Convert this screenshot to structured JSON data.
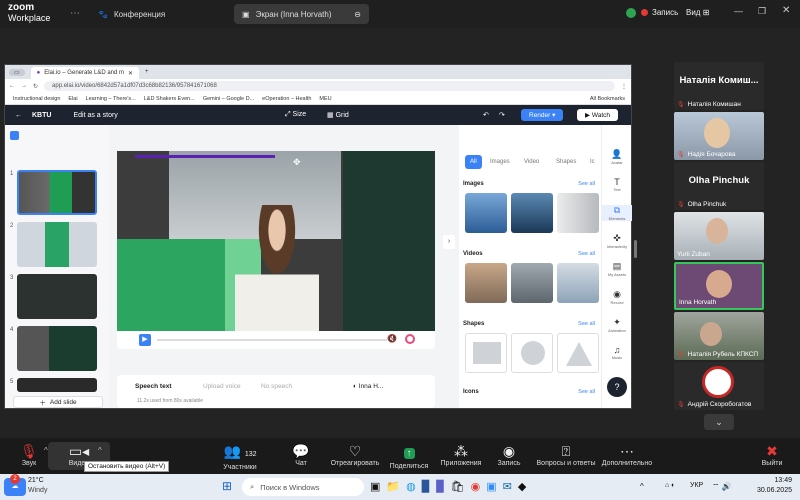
{
  "zoom": {
    "logo_top": "zoom",
    "logo_bottom": "Workplace",
    "tabs": [
      {
        "label": "Конференция",
        "icon": "paw-icon"
      },
      {
        "label": "Экран (Inna Horvath)",
        "icon": "screen-icon"
      }
    ],
    "recording_label": "Запись",
    "view_label": "Вид"
  },
  "browser": {
    "tab_title": "Elai.io – Generate L&D and m",
    "url": "app.elai.io/video/6842d57a1df07d3c68b82136/957841671068",
    "bookmarks": [
      "Instructional design",
      "Elai",
      "Learning – There's...",
      "L&D Shakers Even...",
      "Gemini – Google D...",
      "eOperation – Health",
      "MEU"
    ],
    "all_bookmarks": "All Bookmarks"
  },
  "elai": {
    "project": "KBTU",
    "edit_story": "Edit as a story",
    "size": "Size",
    "grid": "Grid",
    "render": "Render",
    "watch": "Watch",
    "slides": [
      "1",
      "2",
      "3",
      "4",
      "5"
    ],
    "add_slide": "Add slide",
    "panel_tabs": [
      "All",
      "Images",
      "Video",
      "Shapes",
      "Ic"
    ],
    "sections": {
      "images": "Images",
      "videos": "Videos",
      "shapes": "Shapes",
      "icons": "Icons"
    },
    "see_all": "See all",
    "rail": [
      "Avatar",
      "Text",
      "Elements",
      "Interactivity",
      "My Assets",
      "Record",
      "Animation",
      "Music"
    ],
    "speech_tabs": [
      "Speech text",
      "Upload voice",
      "No speech"
    ],
    "speaker": "Inna H...",
    "usage": "11.2s used from 80s available"
  },
  "participants": [
    {
      "big": "Наталія Комиш...",
      "name": "Наталія Комишан"
    },
    {
      "big": "",
      "name": "Надія Бочарова"
    },
    {
      "big": "Olha Pinchuk",
      "name": "Olha Pinchuk"
    },
    {
      "big": "",
      "name": "Yurii Zuban"
    },
    {
      "big": "",
      "name": "Inna Horvath"
    },
    {
      "big": "",
      "name": "Наталія Рубель КПКСП"
    },
    {
      "big": "",
      "name": "Андрій Скоробогатов"
    }
  ],
  "toolbar": {
    "audio": "Звук",
    "video": "Видео",
    "video_tooltip": "Остановить видео (Alt+V)",
    "participants": "Участники",
    "participants_count": "132",
    "chat": "Чат",
    "react": "Отреагировать",
    "share": "Поделиться",
    "apps": "Приложения",
    "record": "Запись",
    "qa": "Вопросы и ответы",
    "more": "Дополнительно",
    "leave": "Выйти"
  },
  "taskbar": {
    "weather_temp": "21°C",
    "weather_desc": "Windy",
    "search_placeholder": "Поиск в Windows",
    "lang": "УКР",
    "time": "13:49",
    "date": "30.06.2025",
    "badge": "2"
  },
  "colors": {
    "accent": "#3b82f6",
    "green": "#1f9d55",
    "zoom_dark": "#1a1a1a"
  }
}
